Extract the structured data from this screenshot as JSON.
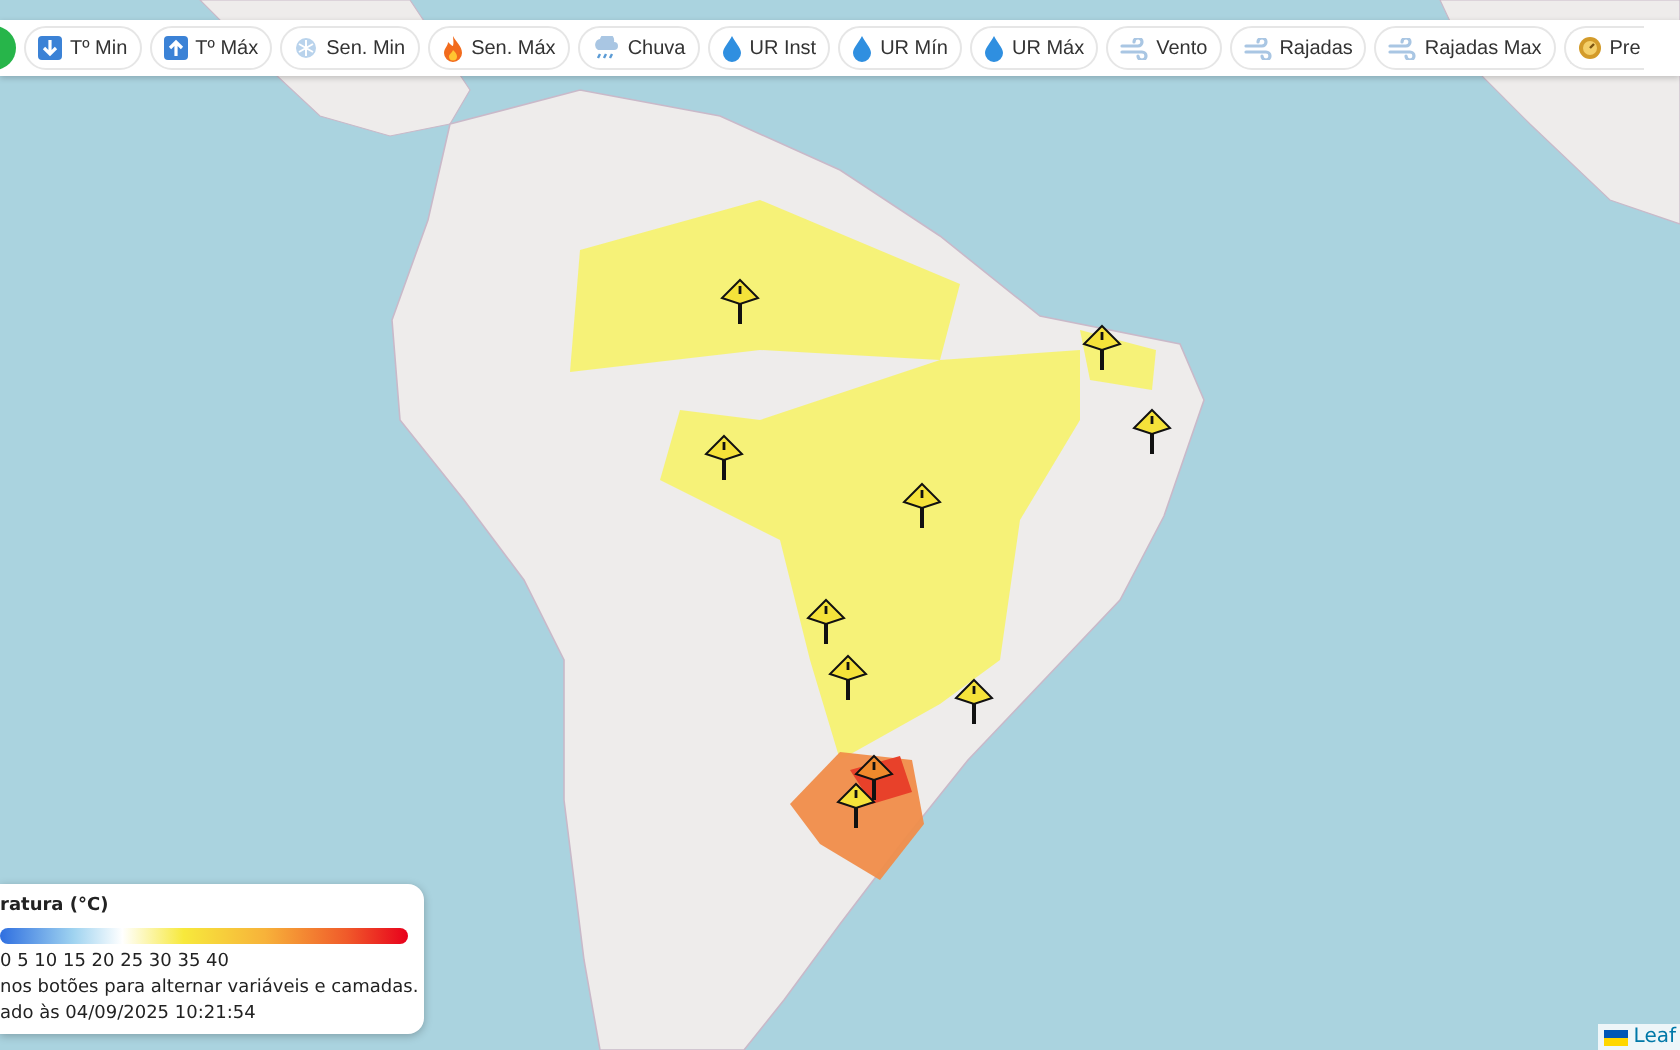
{
  "toolbar": {
    "buttons": [
      {
        "label": "Tº Min",
        "kind": "temp-min"
      },
      {
        "label": "Tº Máx",
        "kind": "temp-max"
      },
      {
        "label": "Sen. Min",
        "kind": "feels-min"
      },
      {
        "label": "Sen. Máx",
        "kind": "feels-max"
      },
      {
        "label": "Chuva",
        "kind": "rain"
      },
      {
        "label": "UR Inst",
        "kind": "humidity"
      },
      {
        "label": "UR Mín",
        "kind": "humidity"
      },
      {
        "label": "UR Máx",
        "kind": "humidity"
      },
      {
        "label": "Vento",
        "kind": "wind"
      },
      {
        "label": "Rajadas",
        "kind": "wind"
      },
      {
        "label": "Rajadas Max",
        "kind": "wind"
      },
      {
        "label": "Pre",
        "kind": "pressure"
      }
    ]
  },
  "legend": {
    "title": "ratura (°C)",
    "scale": "0 5 10 15 20 25 30 35 40",
    "hint": "nos botões para alternar variáveis e camadas.",
    "updated": "ado às 04/09/2025 10:21:54"
  },
  "attribution": {
    "text": "Leaf"
  }
}
